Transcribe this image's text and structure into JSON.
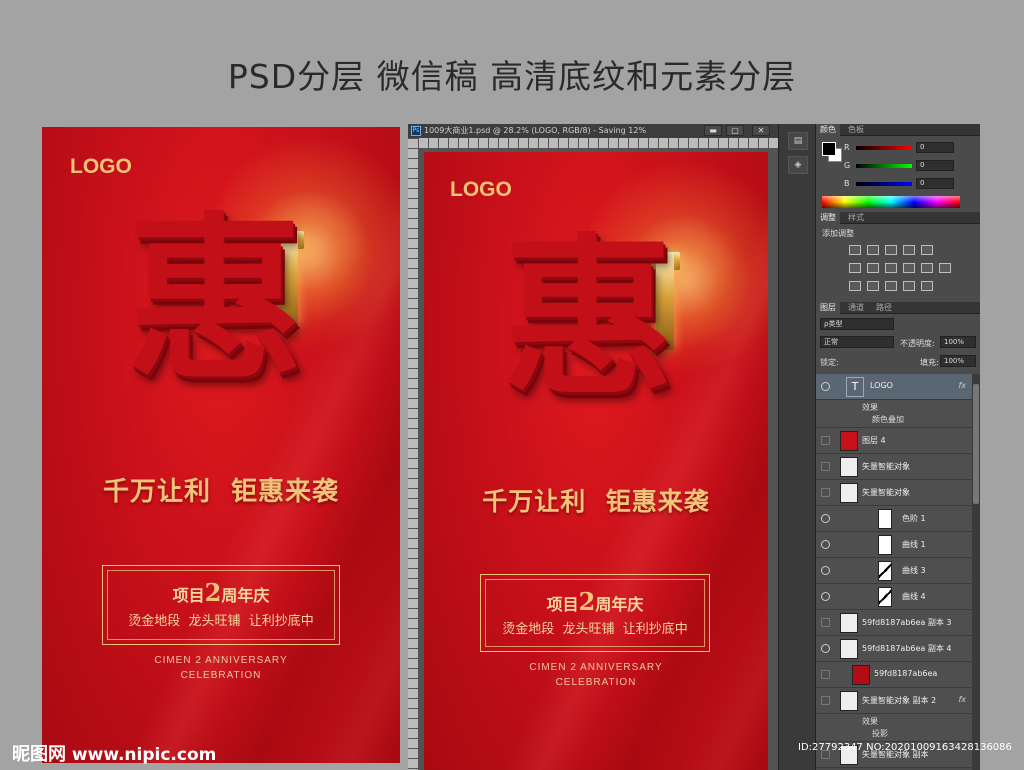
{
  "headline": "PSD分层 微信稿 高清底纹和元素分层",
  "poster": {
    "logo": "LOGO",
    "hero_char": "惠",
    "slogan": "千万让利  钜惠来袭",
    "box_line1_pre": "项目",
    "box_line1_num": "2",
    "box_line1_post": "周年庆",
    "box_line2": "烫金地段  龙头旺铺  让利抄底中",
    "en_line1": "CIMEN 2 ANNIVERSARY",
    "en_line2": "CELEBRATION"
  },
  "ps": {
    "doc_title": "1009大商业1.psd @ 28.2% (LOGO, RGB/8) - Saving 12%",
    "ps_icon": "Ps",
    "window_buttons": [
      "▬",
      "▢",
      "✕"
    ],
    "color_tabs": [
      "颜色",
      "色板"
    ],
    "r_label": "R",
    "g_label": "G",
    "b_label": "B",
    "r_value": "0",
    "g_value": "0",
    "b_value": "0",
    "adjust_tabs": [
      "调整",
      "样式"
    ],
    "adjust_title": "添加调整",
    "layer_tabs": [
      "图层",
      "通道",
      "路径"
    ],
    "kind_filter": "ρ类型",
    "blend_mode": "正常",
    "opacity_label": "不透明度:",
    "opacity_value": "100%",
    "lock_label": "锁定:",
    "fill_label": "填充:",
    "fill_value": "100%",
    "layers": [
      {
        "name": "LOGO",
        "fx": "fx"
      },
      {
        "sub1": "效果",
        "sub2": "颜色叠加"
      },
      {
        "name": "图层 4"
      },
      {
        "name": "矢量智能对象"
      },
      {
        "name": "矢量智能对象"
      },
      {
        "name": "色阶 1"
      },
      {
        "name": "曲线 1"
      },
      {
        "name": "曲线 3"
      },
      {
        "name": "曲线 4"
      },
      {
        "name": "59fd8187ab6ea 副本 3"
      },
      {
        "name": "59fd8187ab6ea 副本 4"
      },
      {
        "name": "59fd8187ab6ea"
      },
      {
        "name": "矢量智能对象 副本 2",
        "fx": "fx"
      },
      {
        "sub1": "效果",
        "sub2": "投影"
      },
      {
        "name": "矢量智能对象 副本"
      }
    ]
  },
  "watermark": {
    "logo_text": "昵图网",
    "url": "www.nipic.com",
    "id_text": "ID:27792347 NO:20201009163428136086"
  },
  "colors": {
    "background": "#a3a3a3",
    "poster_red": "#c8101a",
    "gold": "#f2c47a",
    "ps_dark": "#3a3a3a"
  }
}
